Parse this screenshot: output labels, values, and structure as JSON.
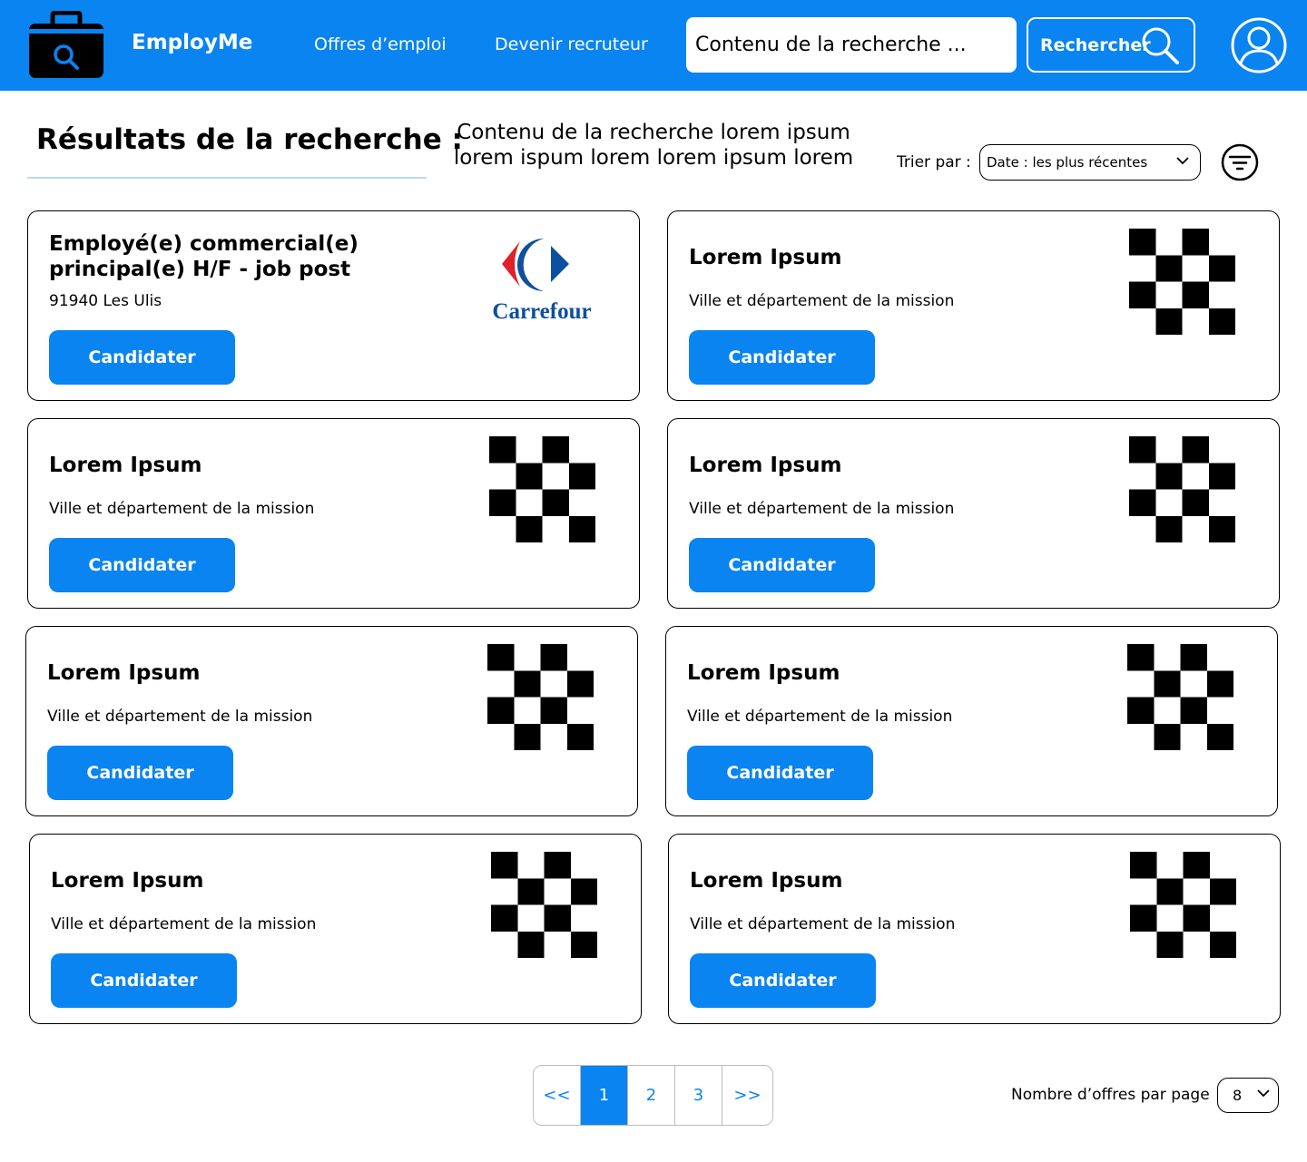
{
  "header": {
    "brand": "EmployMe",
    "nav": [
      "Offres d’emploi",
      "Devenir recruteur"
    ],
    "search_placeholder": "Contenu de la recherche ...",
    "search_button": "Rechercher",
    "color": "#0a84f0"
  },
  "results": {
    "title": "Résultats de la recherche :",
    "query": "Contenu de la recherche lorem ipsum lorem ispum lorem lorem ipsum lorem",
    "sort_label": "Trier par :",
    "sort_value": "Date : les plus récentes"
  },
  "jobs": [
    {
      "title": "Employé(e) commercial(e) principal(e) H/F - job post",
      "location": "91940 Les Ulis",
      "cta": "Candidater",
      "logo": "Carrefour"
    },
    {
      "title": "Lorem Ipsum",
      "location": "Ville et département de la mission",
      "cta": "Candidater",
      "logo": "checkerboard-placeholder"
    },
    {
      "title": "Lorem Ipsum",
      "location": "Ville et département de la mission",
      "cta": "Candidater",
      "logo": "checkerboard-placeholder"
    },
    {
      "title": "Lorem Ipsum",
      "location": "Ville et département de la mission",
      "cta": "Candidater",
      "logo": "checkerboard-placeholder"
    },
    {
      "title": "Lorem Ipsum",
      "location": "Ville et département de la mission",
      "cta": "Candidater",
      "logo": "checkerboard-placeholder"
    },
    {
      "title": "Lorem Ipsum",
      "location": "Ville et département de la mission",
      "cta": "Candidater",
      "logo": "checkerboard-placeholder"
    },
    {
      "title": "Lorem Ipsum",
      "location": "Ville et département de la mission",
      "cta": "Candidater",
      "logo": "checkerboard-placeholder"
    },
    {
      "title": "Lorem Ipsum",
      "location": "Ville et département de la mission",
      "cta": "Candidater",
      "logo": "checkerboard-placeholder"
    }
  ],
  "pagination": {
    "prev": "<<",
    "pages": [
      "1",
      "2",
      "3"
    ],
    "current": "1",
    "next": ">>",
    "per_page_label": "Nombre d’offres par page",
    "per_page_value": "8"
  }
}
